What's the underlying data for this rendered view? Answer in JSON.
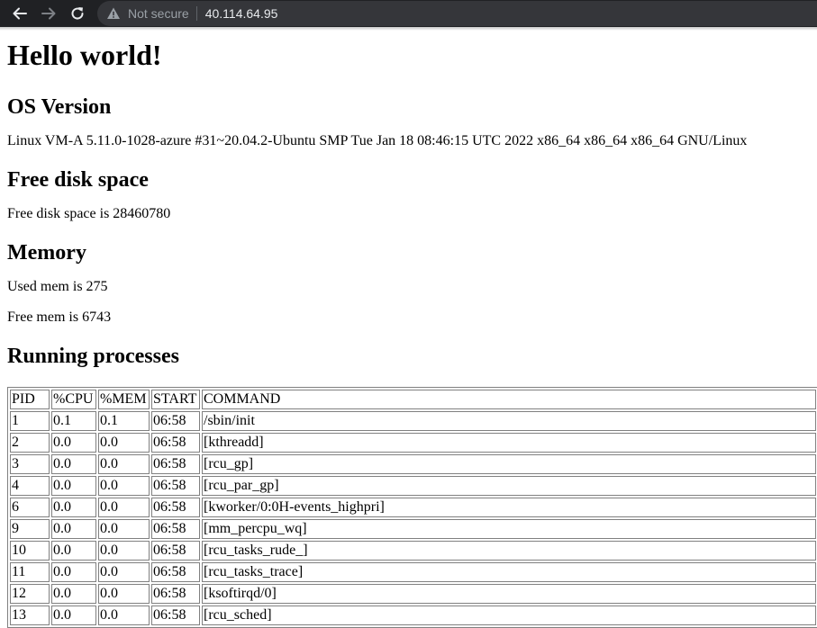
{
  "browser": {
    "security_label": "Not secure",
    "url": "40.114.64.95",
    "chrome_color": "#202124",
    "omnibox_color": "#35363a"
  },
  "page": {
    "title": "Hello world!",
    "os_heading": "OS Version",
    "os_text": "Linux VM-A 5.11.0-1028-azure #31~20.04.2-Ubuntu SMP Tue Jan 18 08:46:15 UTC 2022 x86_64 x86_64 x86_64 GNU/Linux",
    "disk_heading": "Free disk space",
    "disk_text": "Free disk space is 28460780",
    "memory_heading": "Memory",
    "used_mem_text": "Used mem is 275",
    "free_mem_text": "Free mem is 6743",
    "processes_heading": "Running processes"
  },
  "processes": {
    "headers": [
      "PID",
      "%CPU",
      "%MEM",
      "START",
      "COMMAND"
    ],
    "rows": [
      [
        "1",
        "0.1",
        "0.1",
        "06:58",
        "/sbin/init"
      ],
      [
        "2",
        "0.0",
        "0.0",
        "06:58",
        "[kthreadd]"
      ],
      [
        "3",
        "0.0",
        "0.0",
        "06:58",
        "[rcu_gp]"
      ],
      [
        "4",
        "0.0",
        "0.0",
        "06:58",
        "[rcu_par_gp]"
      ],
      [
        "6",
        "0.0",
        "0.0",
        "06:58",
        "[kworker/0:0H-events_highpri]"
      ],
      [
        "9",
        "0.0",
        "0.0",
        "06:58",
        "[mm_percpu_wq]"
      ],
      [
        "10",
        "0.0",
        "0.0",
        "06:58",
        "[rcu_tasks_rude_]"
      ],
      [
        "11",
        "0.0",
        "0.0",
        "06:58",
        "[rcu_tasks_trace]"
      ],
      [
        "12",
        "0.0",
        "0.0",
        "06:58",
        "[ksoftirqd/0]"
      ],
      [
        "13",
        "0.0",
        "0.0",
        "06:58",
        "[rcu_sched]"
      ]
    ]
  }
}
